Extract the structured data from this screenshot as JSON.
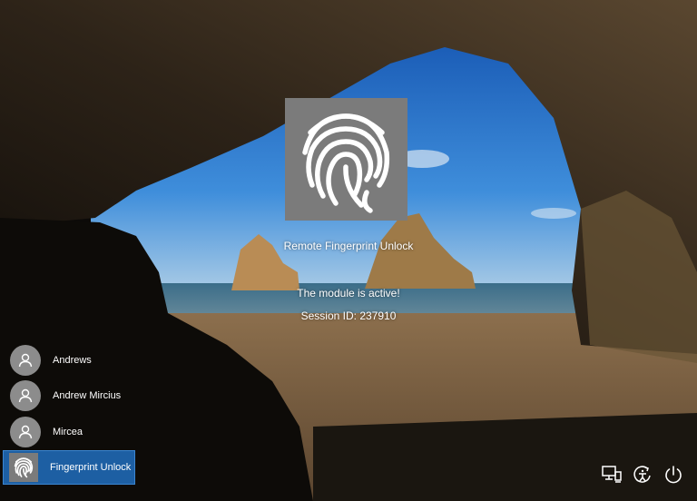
{
  "main": {
    "title": "Remote Fingerprint Unlock",
    "status": "The module is active!",
    "session": "Session ID: 237910",
    "tile_icon": "fingerprint-icon"
  },
  "users": [
    {
      "label": "Andrews",
      "icon": "user-icon",
      "selected": false
    },
    {
      "label": "Andrew Mircius",
      "icon": "user-icon",
      "selected": false
    },
    {
      "label": "Mircea",
      "icon": "user-icon",
      "selected": false
    },
    {
      "label": "Fingerprint Unlock",
      "icon": "fingerprint-icon",
      "selected": true
    }
  ],
  "system_icons": [
    "network-icon",
    "ease-of-access-icon",
    "power-icon"
  ],
  "colors": {
    "selected": "#1d5fa3",
    "tile": "#7b7b7b",
    "avatar": "#8c8c8c"
  }
}
